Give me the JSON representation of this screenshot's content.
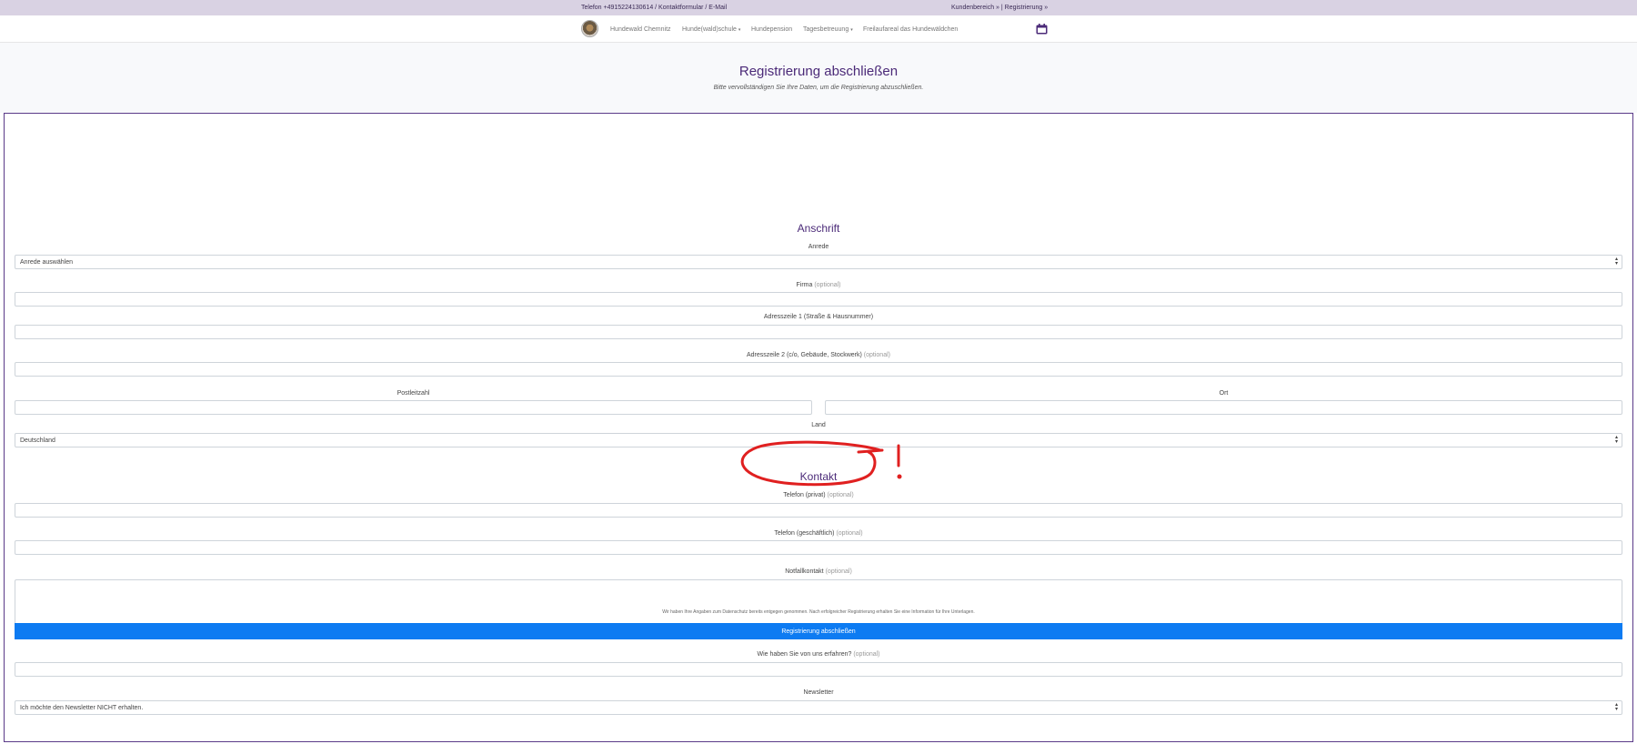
{
  "topbar": {
    "left_text": "Telefon +4915224130614 / Kontaktformular / E-Mail",
    "right_text": "Kundenbereich » | Registrierung »"
  },
  "nav": {
    "items": [
      {
        "label": "Hundewald Chemnitz",
        "dropdown": false
      },
      {
        "label": "Hunde(wald)schule",
        "dropdown": true
      },
      {
        "label": "Hundepension",
        "dropdown": false
      },
      {
        "label": "Tagesbetreuung",
        "dropdown": true
      },
      {
        "label": "Freilaufareal das Hundewäldchen",
        "dropdown": false
      }
    ],
    "caret": "▾",
    "calendar_icon": "calendar-icon"
  },
  "hero": {
    "title": "Registrierung abschließen",
    "subtitle": "Bitte vervollständigen Sie Ihre Daten, um die Registrierung abzuschließen."
  },
  "form": {
    "optional_tag": "(optional)",
    "anschrift": {
      "title": "Anschrift",
      "anrede": {
        "label": "Anrede",
        "value": "Anrede auswählen"
      },
      "firma": {
        "label": "Firma",
        "value": ""
      },
      "adresse1": {
        "label": "Adresszeile 1 (Straße & Hausnummer)",
        "value": ""
      },
      "adresse2": {
        "label": "Adresszeile 2 (c/o, Gebäude, Stockwerk)",
        "value": ""
      },
      "plz": {
        "label": "Postleitzahl",
        "value": ""
      },
      "ort": {
        "label": "Ort",
        "value": ""
      },
      "land": {
        "label": "Land",
        "value": "Deutschland"
      }
    },
    "kontakt": {
      "title": "Kontakt",
      "telefon_privat": {
        "label": "Telefon (privat)",
        "value": ""
      },
      "telefon_geschaeftlich": {
        "label": "Telefon (geschäftlich)",
        "value": ""
      },
      "notfallkontakt": {
        "label": "Notfallkontakt",
        "value": ""
      },
      "erfahren": {
        "label": "Wie haben Sie von uns erfahren?",
        "value": ""
      },
      "newsletter": {
        "label": "Newsletter",
        "value": "Ich möchte den Newsletter NICHT erhalten."
      }
    },
    "privacy_note": "Wir haben Ihre Angaben zum Datenschutz bereits entgegen genommen. Nach erfolgreicher Registrierung erhalten Sie eine Information für Ihre Unterlagen.",
    "submit_label": "Registrierung abschließen"
  },
  "colors": {
    "brand_purple": "#4b2a78",
    "topbar_bg": "#d9d2e3",
    "primary_button": "#0d7bf2",
    "annotation_red": "#e02020"
  },
  "annotation": {
    "exclamation_mark": "!"
  }
}
